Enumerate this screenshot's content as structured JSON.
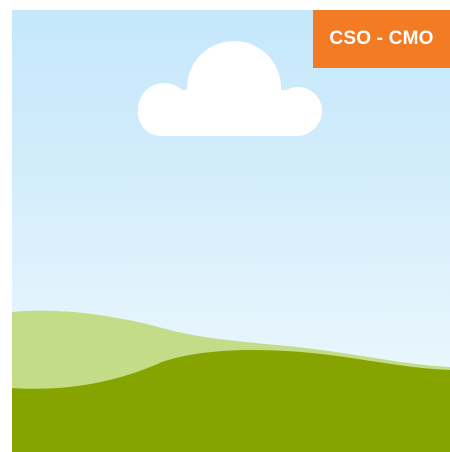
{
  "badge": {
    "label": "CSO - CMO"
  },
  "colors": {
    "badge_background": "#f27b23",
    "badge_text": "#ffffff",
    "sky_top": "#c5e8fb",
    "sky_bottom": "#f1fafe",
    "cloud": "#ffffff",
    "hill_back": "#c3dc87",
    "hill_front": "#87a300"
  },
  "illustration": {
    "icon": "landscape-placeholder-icon"
  }
}
